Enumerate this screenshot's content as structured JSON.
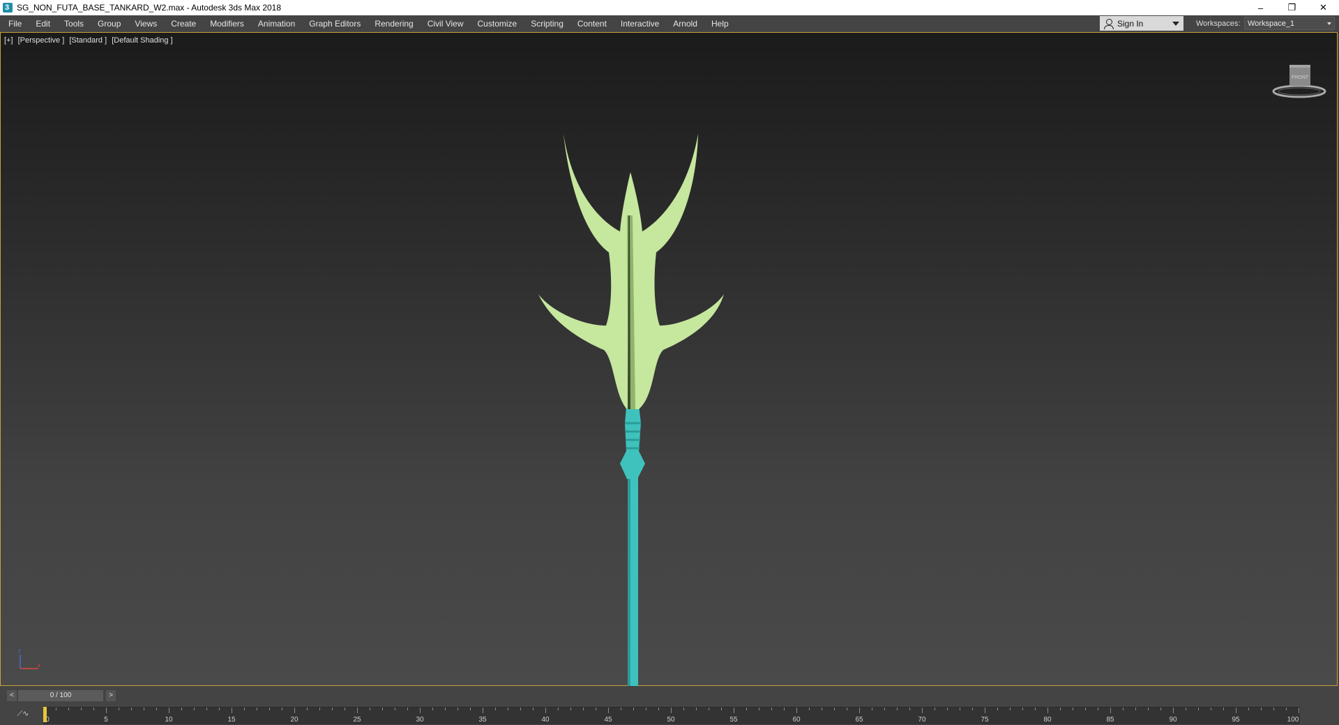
{
  "window": {
    "title": "SG_NON_FUTA_BASE_TANKARD_W2.max - Autodesk 3ds Max 2018",
    "minimize": "–",
    "maximize": "❐",
    "close": "✕"
  },
  "menu": {
    "items": [
      "File",
      "Edit",
      "Tools",
      "Group",
      "Views",
      "Create",
      "Modifiers",
      "Animation",
      "Graph Editors",
      "Rendering",
      "Civil View",
      "Customize",
      "Scripting",
      "Content",
      "Interactive",
      "Arnold",
      "Help"
    ],
    "sign_in": "Sign In",
    "workspaces_label": "Workspaces:",
    "workspace_value": "Workspace_1"
  },
  "viewport": {
    "labels": [
      "[+]",
      "[Perspective ]",
      "[Standard ]",
      "[Default Shading ]"
    ],
    "viewcube_face": "FRONT",
    "colors": {
      "blade": "#c5e79e",
      "shaft": "#3fc2bd",
      "border": "#c8a23a"
    }
  },
  "timeline": {
    "prev": "<",
    "next": ">",
    "frame_display": "0 / 100",
    "current_frame": 0,
    "ticks": [
      "0",
      "5",
      "10",
      "15",
      "20",
      "25",
      "30",
      "35",
      "40",
      "45",
      "50",
      "55",
      "60",
      "65",
      "70",
      "75",
      "80",
      "85",
      "90",
      "95",
      "100"
    ]
  }
}
